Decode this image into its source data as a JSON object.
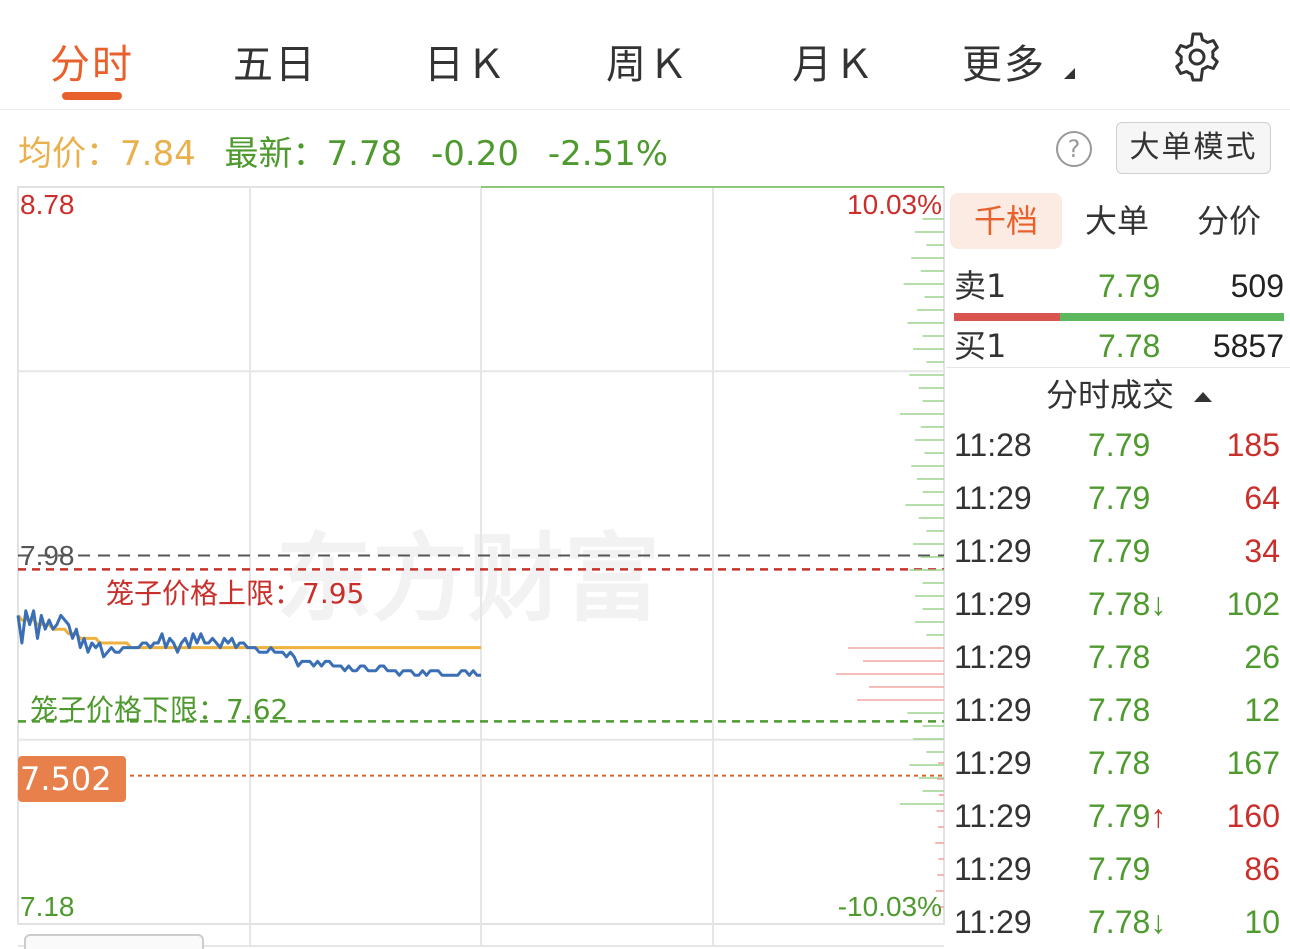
{
  "tabs": [
    {
      "label": "分时",
      "active": true
    },
    {
      "label": "五日"
    },
    {
      "label": "日Ｋ"
    },
    {
      "label": "周Ｋ"
    },
    {
      "label": "月Ｋ"
    },
    {
      "label": "更多"
    }
  ],
  "settings_icon": "gear-icon",
  "quote": {
    "avg_label": "均价：",
    "avg_value": "7.84",
    "last_label": "最新：",
    "last_value": "7.78",
    "change": "-0.20",
    "change_pct": "-2.51%"
  },
  "help_icon": "question-circle-icon",
  "big_order_mode": "大单模式",
  "chart": {
    "price_high": "8.78",
    "price_mid": "7.98",
    "price_low": "7.18",
    "pct_high": "10.03%",
    "pct_low": "-10.03%",
    "cage_upper": "笼子价格上限：7.95",
    "cage_lower": "笼子价格下限：7.62",
    "price_tag": "7.502",
    "watermark": "东方财富",
    "colors": {
      "price_line": "#3a6fb5",
      "avg_line": "#f0b03c",
      "up": "#c9302c",
      "down": "#4e9a2f",
      "tag": "#e8804b"
    }
  },
  "chart_data": {
    "type": "line",
    "ylim": [
      7.18,
      8.78
    ],
    "ref_price": 7.98,
    "levels": {
      "cage_upper": 7.95,
      "cage_lower": 7.62,
      "marker": 7.502
    },
    "series": [
      {
        "name": "price",
        "values": [
          7.85,
          7.79,
          7.86,
          7.83,
          7.86,
          7.8,
          7.85,
          7.82,
          7.84,
          7.82,
          7.83,
          7.85,
          7.84,
          7.83,
          7.8,
          7.82,
          7.78,
          7.8,
          7.77,
          7.79,
          7.78,
          7.79,
          7.76,
          7.77,
          7.78,
          7.77,
          7.77,
          7.78,
          7.78,
          7.78,
          7.78,
          7.78,
          7.79,
          7.79,
          7.78,
          7.79,
          7.79,
          7.81,
          7.78,
          7.8,
          7.79,
          7.77,
          7.79,
          7.8,
          7.78,
          7.81,
          7.79,
          7.81,
          7.79,
          7.79,
          7.8,
          7.79,
          7.78,
          7.8,
          7.79,
          7.8,
          7.78,
          7.79,
          7.79,
          7.78,
          7.78,
          7.78,
          7.77,
          7.77,
          7.77,
          7.78,
          7.77,
          7.77,
          7.77,
          7.76,
          7.77,
          7.76,
          7.74,
          7.75,
          7.75,
          7.75,
          7.74,
          7.75,
          7.74,
          7.75,
          7.75,
          7.74,
          7.74,
          7.74,
          7.73,
          7.74,
          7.73,
          7.73,
          7.74,
          7.74,
          7.73,
          7.73,
          7.73,
          7.74,
          7.74,
          7.73,
          7.73,
          7.73,
          7.72,
          7.73,
          7.73,
          7.73,
          7.72,
          7.72,
          7.73,
          7.72,
          7.73,
          7.73,
          7.73,
          7.72,
          7.72,
          7.72,
          7.72,
          7.72,
          7.73,
          7.73,
          7.72,
          7.73,
          7.72,
          7.72
        ]
      },
      {
        "name": "avg",
        "values": [
          7.85,
          7.84,
          7.84,
          7.84,
          7.84,
          7.83,
          7.83,
          7.83,
          7.83,
          7.82,
          7.82,
          7.82,
          7.82,
          7.81,
          7.81,
          7.81,
          7.8,
          7.8,
          7.8,
          7.8,
          7.8,
          7.79,
          7.79,
          7.79,
          7.79,
          7.79,
          7.79,
          7.79,
          7.79,
          7.78,
          7.78,
          7.78,
          7.78,
          7.78,
          7.78,
          7.78,
          7.78,
          7.78,
          7.78,
          7.78,
          7.78,
          7.78,
          7.78,
          7.78,
          7.78,
          7.78,
          7.78,
          7.78,
          7.78,
          7.78,
          7.78,
          7.78,
          7.78,
          7.78,
          7.78,
          7.78,
          7.78,
          7.78,
          7.78,
          7.78,
          7.78,
          7.78,
          7.78,
          7.78,
          7.78,
          7.78,
          7.78,
          7.78,
          7.78,
          7.78,
          7.78,
          7.78,
          7.78,
          7.78,
          7.78,
          7.78,
          7.78,
          7.78,
          7.78,
          7.78,
          7.78,
          7.78,
          7.78,
          7.78,
          7.78,
          7.78,
          7.78,
          7.78,
          7.78,
          7.78,
          7.78,
          7.78,
          7.78,
          7.78,
          7.78,
          7.78,
          7.78,
          7.78,
          7.78,
          7.78,
          7.78,
          7.78,
          7.78,
          7.78,
          7.78,
          7.78,
          7.78,
          7.78,
          7.78,
          7.78,
          7.78,
          7.78,
          7.78,
          7.78,
          7.78,
          7.78,
          7.78,
          7.78,
          7.78,
          7.78
        ]
      }
    ]
  },
  "order_book": {
    "tabs": [
      {
        "label": "千档",
        "active": true
      },
      {
        "label": "大单"
      },
      {
        "label": "分价"
      }
    ],
    "sell": {
      "label": "卖1",
      "price": "7.79",
      "volume": "509"
    },
    "buy": {
      "label": "买1",
      "price": "7.78",
      "volume": "5857"
    },
    "buy_ratio": 0.68
  },
  "trades": {
    "title": "分时成交",
    "rows": [
      {
        "time": "11:28",
        "price": "7.79",
        "arrow": "",
        "volume": "185",
        "side": "up"
      },
      {
        "time": "11:29",
        "price": "7.79",
        "arrow": "",
        "volume": "64",
        "side": "up"
      },
      {
        "time": "11:29",
        "price": "7.79",
        "arrow": "",
        "volume": "34",
        "side": "up"
      },
      {
        "time": "11:29",
        "price": "7.78",
        "arrow": "↓",
        "volume": "102",
        "side": "down"
      },
      {
        "time": "11:29",
        "price": "7.78",
        "arrow": "",
        "volume": "26",
        "side": "down"
      },
      {
        "time": "11:29",
        "price": "7.78",
        "arrow": "",
        "volume": "12",
        "side": "down"
      },
      {
        "time": "11:29",
        "price": "7.78",
        "arrow": "",
        "volume": "167",
        "side": "down"
      },
      {
        "time": "11:29",
        "price": "7.79",
        "arrow": "↑",
        "volume": "160",
        "side": "up"
      },
      {
        "time": "11:29",
        "price": "7.79",
        "arrow": "",
        "volume": "86",
        "side": "up"
      },
      {
        "time": "11:29",
        "price": "7.78",
        "arrow": "↓",
        "volume": "10",
        "side": "down"
      }
    ]
  }
}
